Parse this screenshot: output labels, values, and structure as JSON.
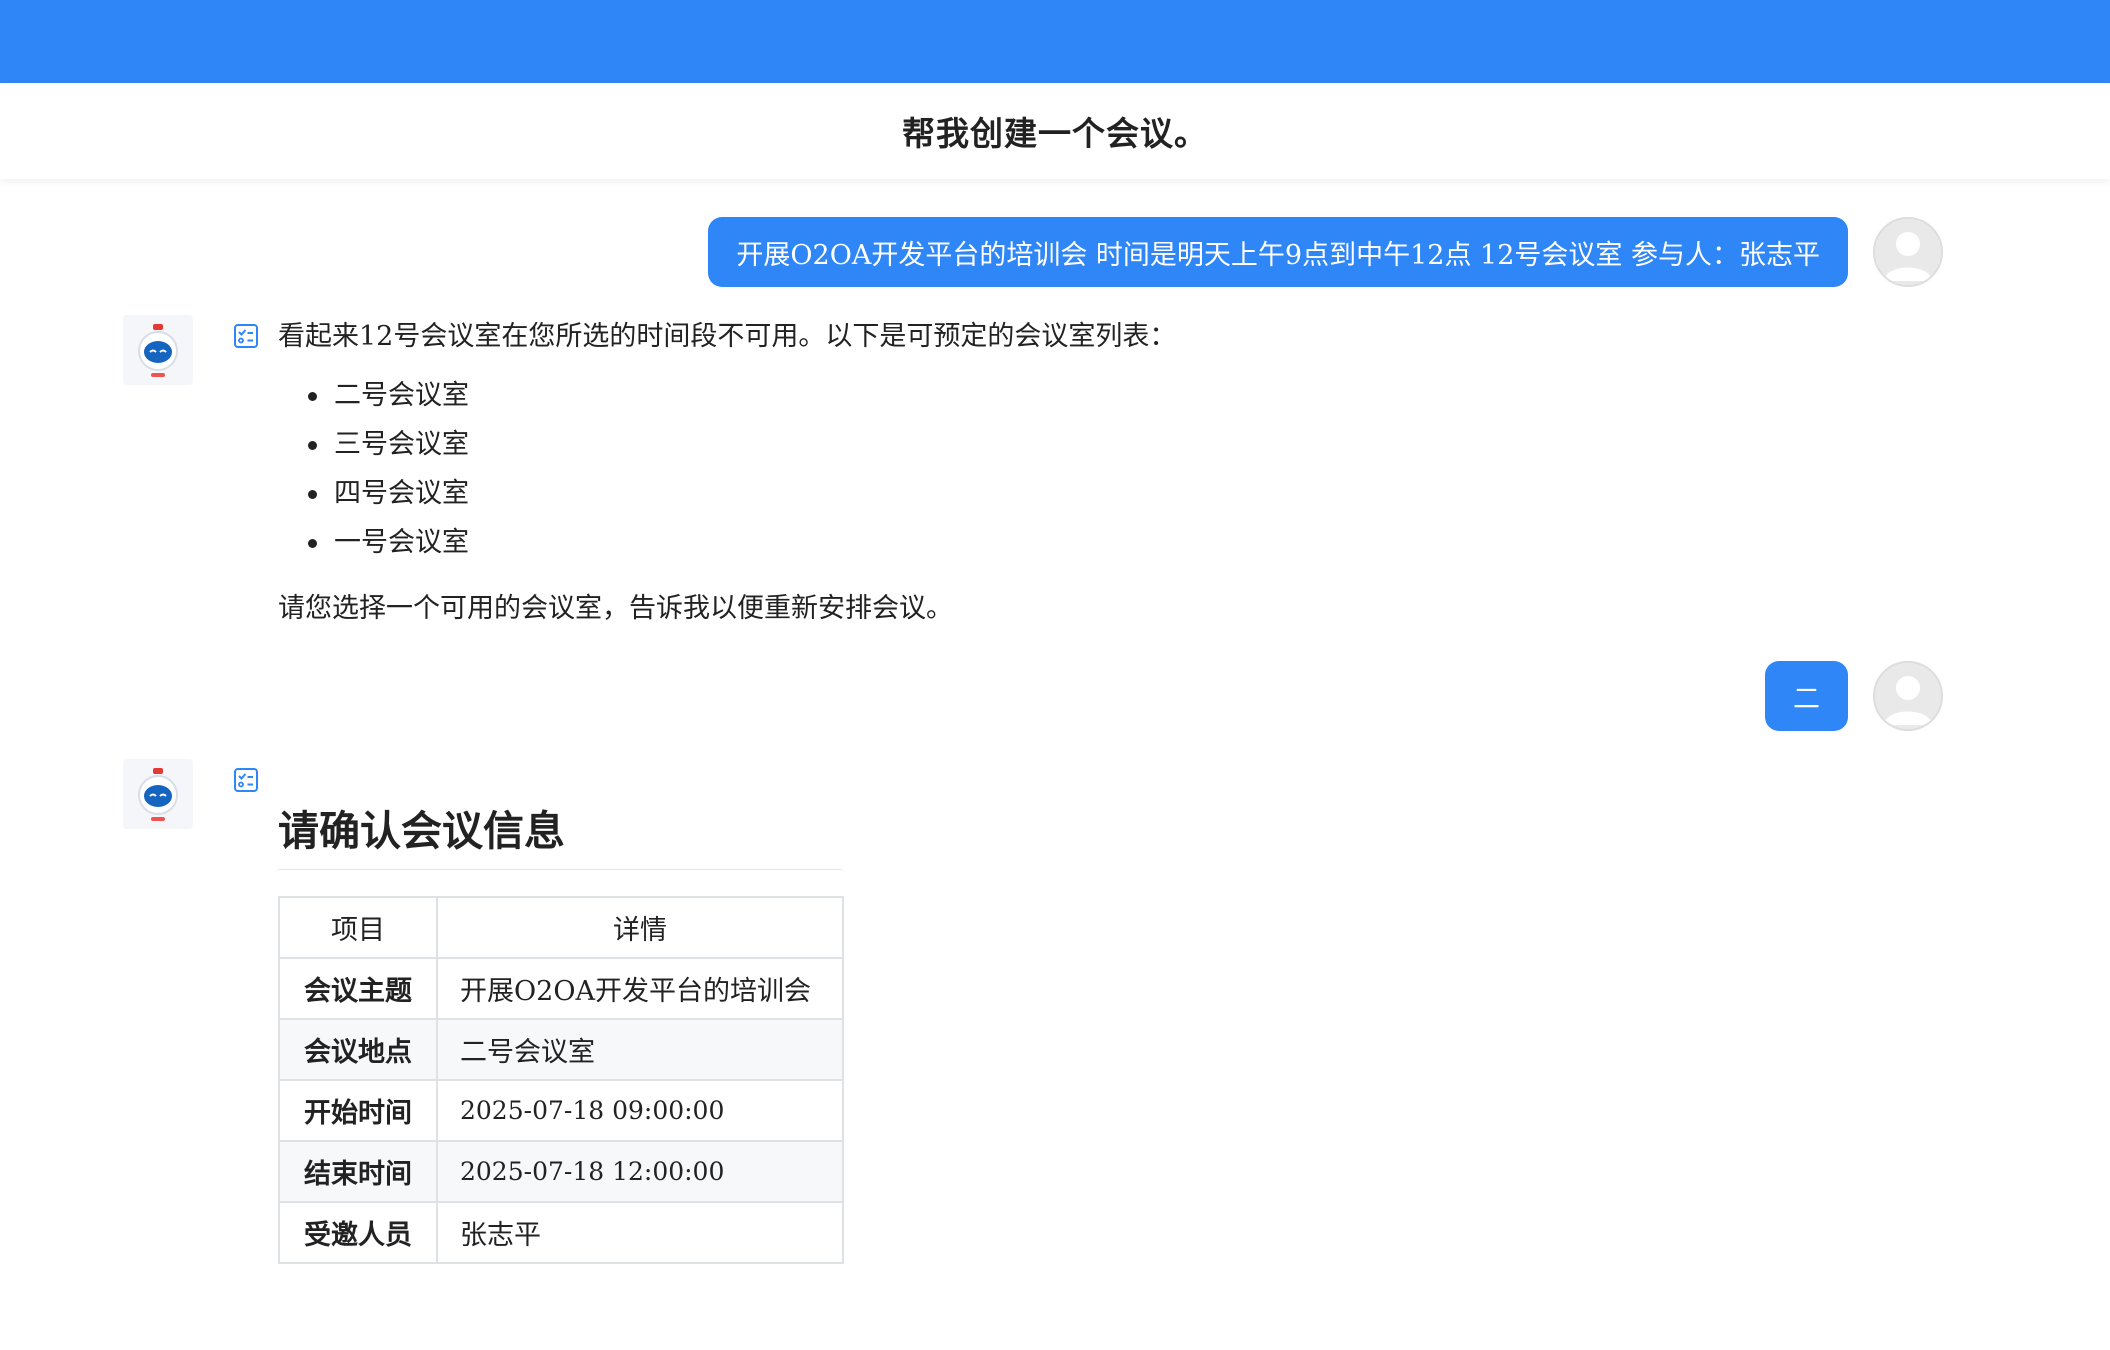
{
  "header": {
    "title": "帮我创建一个会议。"
  },
  "conversation": {
    "user_message_1": "开展O2OA开发平台的培训会 时间是明天上午9点到中午12点 12号会议室 参与人：张志平",
    "bot_message_1": {
      "intro": "看起来12号会议室在您所选的时间段不可用。以下是可预定的会议室列表：",
      "rooms": [
        "二号会议室",
        "三号会议室",
        "四号会议室",
        "一号会议室"
      ],
      "outro": "请您选择一个可用的会议室，告诉我以便重新安排会议。"
    },
    "user_message_2": "二",
    "bot_message_2": {
      "title": "请确认会议信息",
      "table": {
        "headers": [
          "项目",
          "详情"
        ],
        "rows": [
          [
            "会议主题",
            "开展O2OA开发平台的培训会"
          ],
          [
            "会议地点",
            "二号会议室"
          ],
          [
            "开始时间",
            "2025-07-18 09:00:00"
          ],
          [
            "结束时间",
            "2025-07-18 12:00:00"
          ],
          [
            "受邀人员",
            "张志平"
          ]
        ]
      }
    }
  },
  "icons": {
    "user_avatar": "user-avatar-icon",
    "bot_avatar": "robot-avatar-icon",
    "message_type": "checklist-icon"
  },
  "colors": {
    "primary": "#2f86f6",
    "user_bubble_text": "#ffffff",
    "table_border": "#dfe2e5",
    "table_alt_row": "#f6f8fa"
  }
}
